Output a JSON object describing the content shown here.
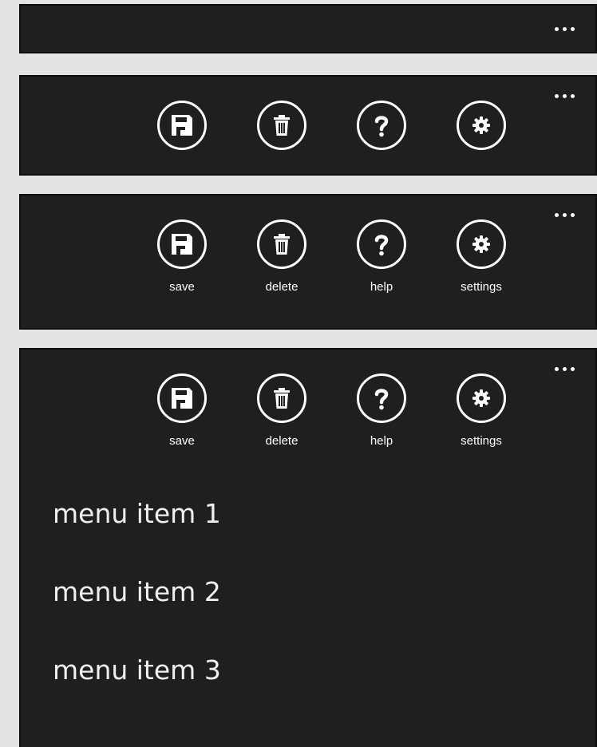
{
  "app_bars": [
    {
      "state": "minimized"
    },
    {
      "state": "compact",
      "buttons": [
        "save-icon",
        "delete-icon",
        "help-icon",
        "settings-icon"
      ]
    },
    {
      "state": "labeled",
      "buttons": [
        "save-icon",
        "delete-icon",
        "help-icon",
        "settings-icon"
      ]
    },
    {
      "state": "expanded",
      "buttons": [
        "save-icon",
        "delete-icon",
        "help-icon",
        "settings-icon"
      ]
    }
  ],
  "buttons": {
    "save_label": "save",
    "delete_label": "delete",
    "help_label": "help",
    "settings_label": "settings"
  },
  "menu": {
    "items": [
      "menu item 1",
      "menu item 2",
      "menu item 3"
    ]
  },
  "colors": {
    "bar_background": "#1f1f1f",
    "page_background": "#e4e4e4",
    "foreground": "#ffffff"
  }
}
